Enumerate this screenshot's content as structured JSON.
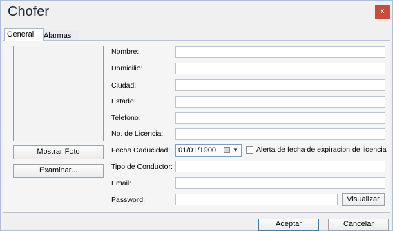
{
  "window": {
    "title": "Chofer",
    "close_label": "x"
  },
  "tabs": [
    {
      "label": "General"
    },
    {
      "label": "Alarmas"
    }
  ],
  "photo_panel": {
    "show_photo_label": "Mostrar Foto",
    "browse_label": "Examinar..."
  },
  "form": {
    "nombre_label": "Nombre:",
    "domicilio_label": "Domicilio:",
    "ciudad_label": "Ciudad:",
    "estado_label": "Estado:",
    "telefono_label": "Telefono:",
    "licencia_label": "No. de Licencia:",
    "fecha_label": "Fecha Caducidad:",
    "fecha_value": "01/01/1900",
    "alerta_label": "Alerta de fecha de expiracion de licencia",
    "tipo_label": "Tipo de Conductor:",
    "email_label": "Email:",
    "password_label": "Password:",
    "visualizar_label": "Visualizar"
  },
  "footer": {
    "accept_label": "Aceptar",
    "cancel_label": "Cancelar"
  }
}
